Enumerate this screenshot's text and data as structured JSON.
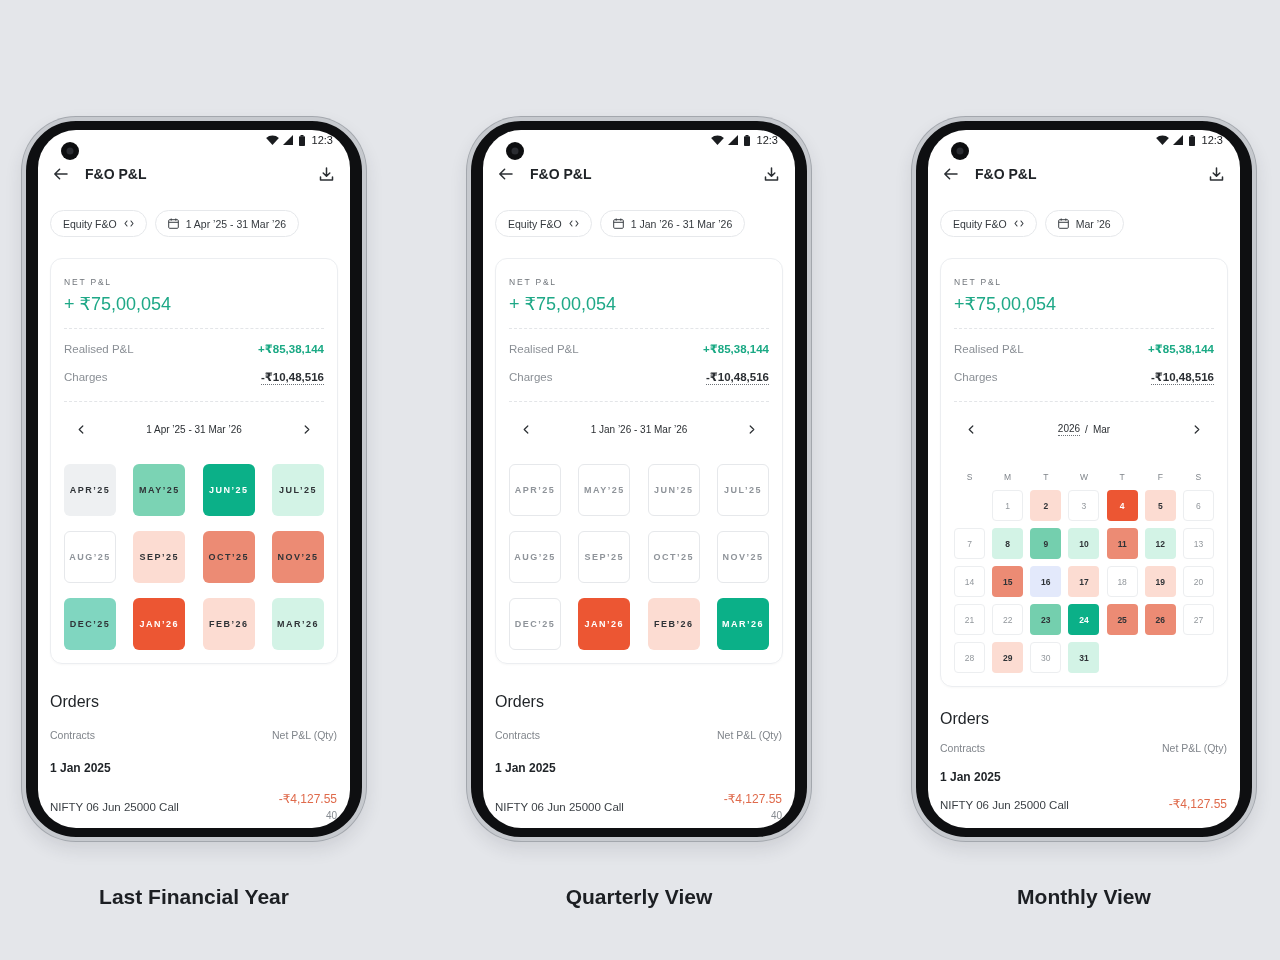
{
  "phones": [
    {
      "status_bar": {
        "time": "12:3"
      },
      "header": {
        "title": "F&O P&L"
      },
      "filters": {
        "segment": "Equity F&O",
        "period": "1 Apr ’25 - 31 Mar ’26"
      },
      "summary": {
        "label": "NET P&L",
        "net_pnl": "+ ₹75,00,054",
        "rows": [
          {
            "label": "Realised P&L",
            "value": "+₹85,38,144",
            "kind": "gain"
          },
          {
            "label": "Charges",
            "value": "-₹10,48,516",
            "kind": "charges"
          }
        ]
      },
      "period_nav": {
        "kind": "range",
        "label": "1 Apr ’25 - 31 Mar ’26"
      },
      "month_grid": [
        {
          "label": "APR’25",
          "disabled": false,
          "color": "#eef0f2"
        },
        {
          "label": "MAY’25",
          "disabled": false,
          "color": "#7bd3b4"
        },
        {
          "label": "JUN’25",
          "disabled": false,
          "color": "#0bb088"
        },
        {
          "label": "JUL’25",
          "disabled": false,
          "color": "#d3f3e6"
        },
        {
          "label": "AUG’25",
          "disabled": true
        },
        {
          "label": "SEP’25",
          "disabled": false,
          "color": "#fcdcd2"
        },
        {
          "label": "OCT’25",
          "disabled": false,
          "color": "#ec8b74"
        },
        {
          "label": "NOV’25",
          "disabled": false,
          "color": "#ec8b74"
        },
        {
          "label": "DEC’25",
          "disabled": false,
          "color": "#80d6c0"
        },
        {
          "label": "JAN’26",
          "disabled": false,
          "color": "#ec5633"
        },
        {
          "label": "FEB’26",
          "disabled": false,
          "color": "#fcdcd2"
        },
        {
          "label": "MAR’26",
          "disabled": false,
          "color": "#d3f3e6"
        }
      ],
      "orders": {
        "title": "Orders",
        "columns": [
          "Contracts",
          "Net P&L (Qty)"
        ],
        "groups": [
          {
            "date": "1 Jan 2025",
            "rows": [
              {
                "contract": "NIFTY 06 Jun 25000 Call",
                "pnl": "-₹4,127.55",
                "qty": "40"
              }
            ]
          }
        ]
      },
      "caption": "Last Financial Year"
    },
    {
      "status_bar": {
        "time": "12:3"
      },
      "header": {
        "title": "F&O P&L"
      },
      "filters": {
        "segment": "Equity F&O",
        "period": "1 Jan ’26 - 31 Mar ’26"
      },
      "summary": {
        "label": "NET P&L",
        "net_pnl": "+ ₹75,00,054",
        "rows": [
          {
            "label": "Realised P&L",
            "value": "+₹85,38,144",
            "kind": "gain"
          },
          {
            "label": "Charges",
            "value": "-₹10,48,516",
            "kind": "charges"
          }
        ]
      },
      "period_nav": {
        "kind": "range",
        "label": "1 Jan ’26 - 31 Mar ’26"
      },
      "month_grid": [
        {
          "label": "APR’25",
          "disabled": true
        },
        {
          "label": "MAY’25",
          "disabled": true
        },
        {
          "label": "JUN’25",
          "disabled": true
        },
        {
          "label": "JUL’25",
          "disabled": true
        },
        {
          "label": "AUG’25",
          "disabled": true
        },
        {
          "label": "SEP’25",
          "disabled": true
        },
        {
          "label": "OCT’25",
          "disabled": true
        },
        {
          "label": "NOV’25",
          "disabled": true
        },
        {
          "label": "DEC’25",
          "disabled": true
        },
        {
          "label": "JAN’26",
          "disabled": false,
          "color": "#ec5633"
        },
        {
          "label": "FEB’26",
          "disabled": false,
          "color": "#fcdcd2"
        },
        {
          "label": "MAR’26",
          "disabled": false,
          "color": "#0bb088"
        }
      ],
      "orders": {
        "title": "Orders",
        "columns": [
          "Contracts",
          "Net P&L (Qty)"
        ],
        "groups": [
          {
            "date": "1 Jan 2025",
            "rows": [
              {
                "contract": "NIFTY 06 Jun 25000 Call",
                "pnl": "-₹4,127.55",
                "qty": "40"
              }
            ]
          }
        ]
      },
      "caption": "Quarterly View"
    },
    {
      "status_bar": {
        "time": "12:3"
      },
      "header": {
        "title": "F&O P&L"
      },
      "filters": {
        "segment": "Equity F&O",
        "period": "Mar ’26"
      },
      "summary": {
        "label": "NET P&L",
        "net_pnl": "+₹75,00,054",
        "rows": [
          {
            "label": "Realised P&L",
            "value": "+₹85,38,144",
            "kind": "gain"
          },
          {
            "label": "Charges",
            "value": "-₹10,48,516",
            "kind": "charges"
          }
        ]
      },
      "period_nav": {
        "kind": "month",
        "year": "2026",
        "separator": "/",
        "month": "Mar"
      },
      "calendar": {
        "weekdays": [
          "S",
          "M",
          "T",
          "W",
          "T",
          "F",
          "S"
        ],
        "weeks": [
          {
            "days": [
              {
                "label": "1",
                "disabled": true
              },
              {
                "label": "2",
                "disabled": false,
                "color": "#fcdcd2"
              },
              {
                "label": "3",
                "disabled": true
              },
              {
                "label": "4",
                "disabled": false,
                "color": "#ec5633"
              },
              {
                "label": "5",
                "disabled": false,
                "color": "#fcdcd2"
              },
              {
                "label": "6",
                "disabled": true
              }
            ]
          },
          {
            "days": [
              {
                "label": "7",
                "disabled": true
              },
              {
                "label": "8",
                "disabled": false,
                "color": "#d3f3e6"
              },
              {
                "label": "9",
                "disabled": false,
                "color": "#74cfae"
              },
              {
                "label": "10",
                "disabled": false,
                "color": "#d3f3e6"
              },
              {
                "label": "11",
                "disabled": false,
                "color": "#ec8b74"
              },
              {
                "label": "12",
                "disabled": false,
                "color": "#d3f3e6"
              },
              {
                "label": "13",
                "disabled": true
              }
            ]
          },
          {
            "days": [
              {
                "label": "14",
                "disabled": true
              },
              {
                "label": "15",
                "disabled": false,
                "color": "#ec8b74"
              },
              {
                "label": "16",
                "disabled": false,
                "color": "#e3e9fb"
              },
              {
                "label": "17",
                "disabled": false,
                "color": "#fcdcd2"
              },
              {
                "label": "18",
                "disabled": true
              },
              {
                "label": "19",
                "disabled": false,
                "color": "#fcdcd2"
              },
              {
                "label": "20",
                "disabled": true
              }
            ]
          },
          {
            "days": [
              {
                "label": "21",
                "disabled": true
              },
              {
                "label": "22",
                "disabled": true
              },
              {
                "label": "23",
                "disabled": false,
                "color": "#74cfae"
              },
              {
                "label": "24",
                "disabled": false,
                "color": "#0bb088"
              },
              {
                "label": "25",
                "disabled": false,
                "color": "#ec8b74"
              },
              {
                "label": "26",
                "disabled": false,
                "color": "#ec8b74"
              },
              {
                "label": "27",
                "disabled": true
              }
            ]
          },
          {
            "days": [
              {
                "label": "28",
                "disabled": true
              },
              {
                "label": "29",
                "disabled": false,
                "color": "#fcdcd2"
              },
              {
                "label": "30",
                "disabled": true
              },
              {
                "label": "31",
                "disabled": false,
                "color": "#d3f3e6"
              }
            ]
          }
        ]
      },
      "orders": {
        "title": "Orders",
        "columns": [
          "Contracts",
          "Net P&L (Qty)"
        ],
        "groups": [
          {
            "date": "1 Jan 2025",
            "rows": [
              {
                "contract": "NIFTY 06 Jun 25000 Call",
                "pnl": "-₹4,127.55"
              }
            ]
          }
        ]
      },
      "caption": "Monthly View"
    }
  ]
}
